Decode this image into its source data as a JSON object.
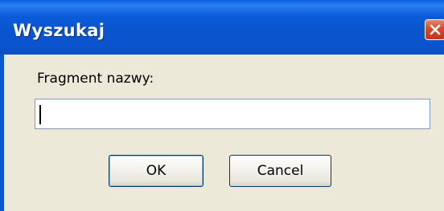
{
  "window": {
    "title": "Wyszukaj",
    "close_icon": "close-icon"
  },
  "dialog": {
    "field_label": "Fragment nazwy:",
    "field_value": "",
    "ok_label": "OK",
    "cancel_label": "Cancel"
  },
  "colors": {
    "titlebar": "#0a55cf",
    "dialog_background": "#ece9d8",
    "close_button": "#d9482c",
    "button_border": "#003c74"
  }
}
